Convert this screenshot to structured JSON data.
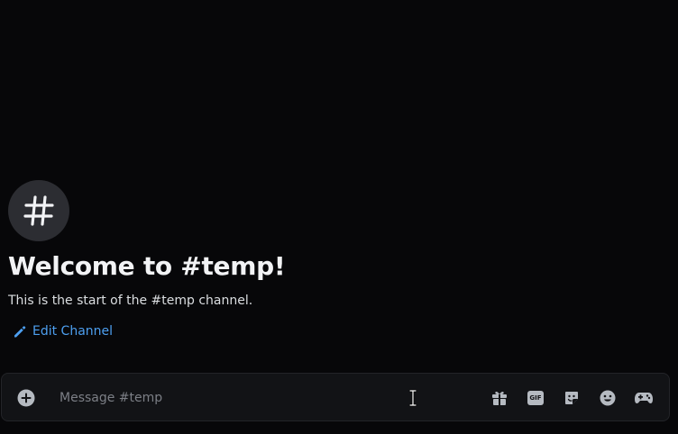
{
  "channel": {
    "avatar_glyph": "#",
    "welcome_title": "Welcome to #temp!",
    "welcome_subtitle": "This is the start of the #temp channel.",
    "edit_label": "Edit Channel"
  },
  "composer": {
    "placeholder": "Message #temp",
    "value": "",
    "tools": {
      "gift": "gift-icon",
      "gif": "GIF",
      "sticker": "sticker-icon",
      "emoji": "emoji-icon",
      "activities": "gamepad-icon"
    }
  },
  "colors": {
    "background": "#070709",
    "composer": "#121316",
    "accent_link": "#4d9ff0",
    "icon": "#b5bac1"
  }
}
